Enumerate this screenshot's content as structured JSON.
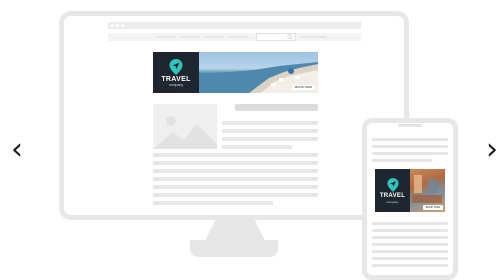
{
  "carousel": {
    "prev_glyph": "‹",
    "next_glyph": "›"
  },
  "desktop_ad": {
    "brand": "TRAVEL",
    "tagline": "company",
    "cta": "BOOK NOW"
  },
  "mobile_ad": {
    "brand": "TRAVEL",
    "tagline": "company",
    "cta": "BOOK NOW"
  },
  "colors": {
    "device_frame": "#e7e7e7",
    "placeholder_line": "#e6e6e6",
    "ad_dark": "#1e2730",
    "logo_teal": "#2fc4c0"
  },
  "icons": [
    "chevron-left-icon",
    "chevron-right-icon",
    "map-pin-icon",
    "image-placeholder-icon",
    "search-icon"
  ]
}
